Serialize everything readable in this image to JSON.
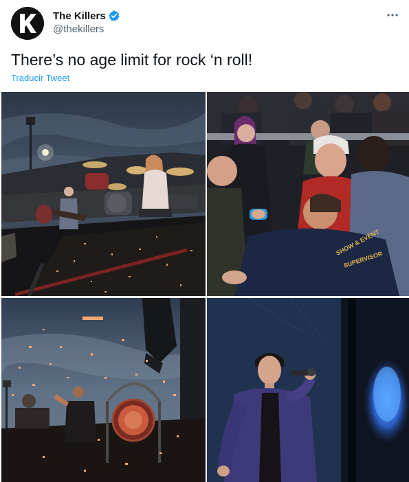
{
  "tweet": {
    "author": {
      "display_name": "The Killers",
      "handle": "@thekillers",
      "verified": true,
      "avatar_icon": "killers-k-logo",
      "avatar_letter": "K"
    },
    "text": "There’s no age limit for rock ‘n roll!",
    "translate_label": "Traducir Tweet",
    "more_icon": "ellipsis-icon",
    "photos": [
      {
        "name": "photo-drummer-on-stage-dusk"
      },
      {
        "name": "photo-elderly-fan-meeting-singer"
      },
      {
        "name": "photo-gong-confetti-stage"
      },
      {
        "name": "photo-singer-purple-jacket-microphone"
      }
    ],
    "photo_texts": {
      "jacket_line1": "SHOW & EVENT",
      "jacket_line2": "SUPERVISOR"
    }
  },
  "colors": {
    "text": "#0f1419",
    "secondary": "#536471",
    "link": "#1d9bf0",
    "verified": "#1d9bf0"
  }
}
